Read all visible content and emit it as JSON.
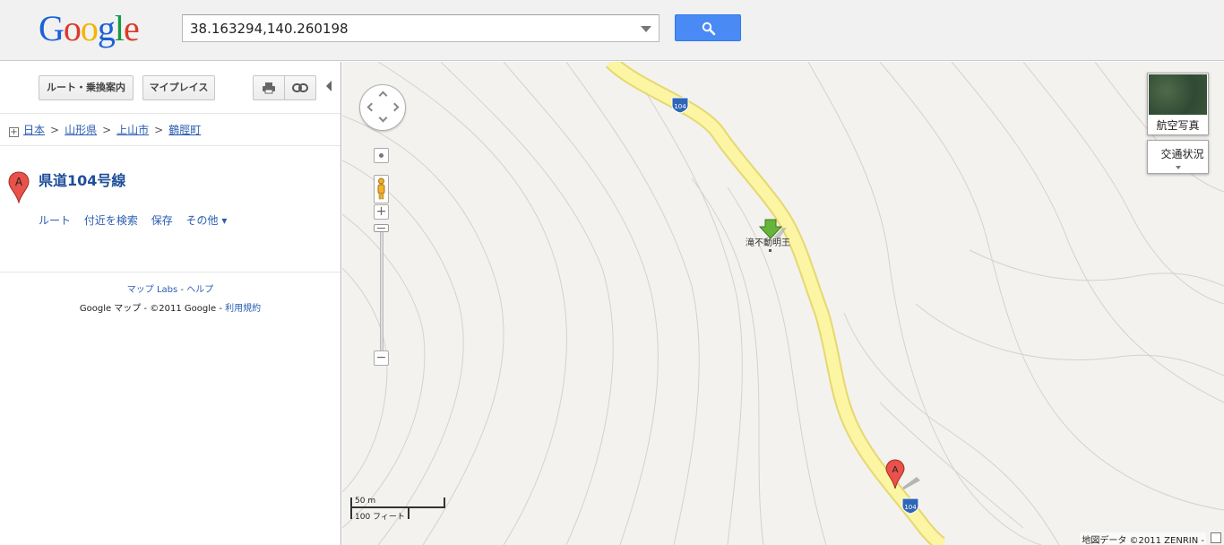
{
  "header": {
    "logo_letters": [
      {
        "ch": "G",
        "color": "#1a62d6"
      },
      {
        "ch": "o",
        "color": "#dd3b2a"
      },
      {
        "ch": "o",
        "color": "#f4b400"
      },
      {
        "ch": "g",
        "color": "#1a62d6"
      },
      {
        "ch": "l",
        "color": "#139a43"
      },
      {
        "ch": "e",
        "color": "#dd3b2a"
      }
    ],
    "search_value": "38.163294,140.260198"
  },
  "sidebar": {
    "directions_label": "ルート・乗換案内",
    "myplaces_label": "マイプレイス",
    "breadcrumb": [
      "日本",
      "山形県",
      "上山市",
      "鶴脛町"
    ],
    "result": {
      "marker_letter": "A",
      "title": "県道104号線",
      "actions": [
        "ルート",
        "付近を検索",
        "保存",
        "その他 ▾"
      ]
    },
    "footer": {
      "labs": "マップ Labs",
      "help": "ヘルプ",
      "copyright": "Google マップ - ©2011 Google - ",
      "terms": "利用規約"
    }
  },
  "map": {
    "aerial_label": "航空写真",
    "traffic_label": "交通状況",
    "poi_label": "滝不動明王",
    "road_shield": "104",
    "marker_letter": "A",
    "scale_metric": "50 m",
    "scale_imperial": "100 フィート",
    "copyright": "地図データ ©2011 ZENRIN -",
    "colors": {
      "road_fill": "#fbf5a4",
      "road_edge": "#e6d870",
      "background": "#f3f2ef",
      "contour": "#d4d2cc",
      "marker_red": "#e8524a",
      "arrow_green": "#66b53a"
    }
  }
}
